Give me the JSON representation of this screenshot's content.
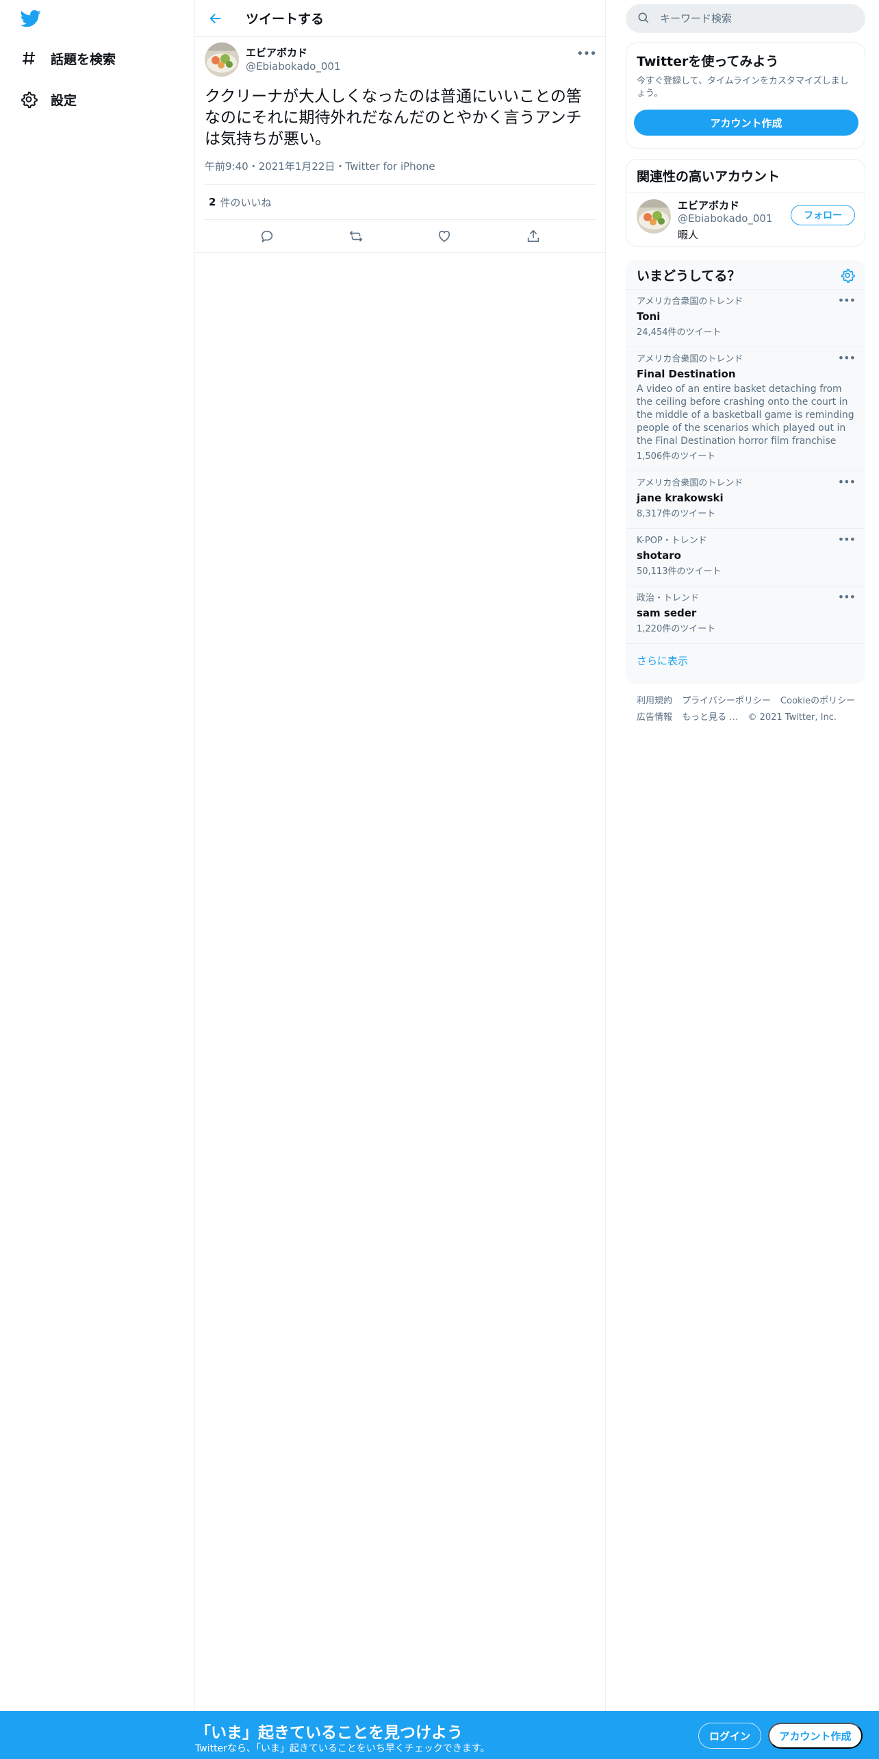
{
  "nav": {
    "explore_label": "話題を検索",
    "settings_label": "設定"
  },
  "header": {
    "title": "ツイートする"
  },
  "tweet": {
    "author_name": "エビアボカド",
    "author_handle": "@Ebiabokado_001",
    "text": "ククリーナが大人しくなったのは普通にいいことの筈なのにそれに期待外れだなんだのとやかく言うアンチは気持ちが悪い。",
    "time": "午前9:40",
    "sep1": "・",
    "date": "2021年1月22日",
    "sep2": "・",
    "source": "Twitter for iPhone",
    "like_count": "2",
    "like_label": "件のいいね"
  },
  "search": {
    "placeholder": "キーワード検索"
  },
  "signup_card": {
    "title": "Twitterを使ってみよう",
    "subtitle": "今すぐ登録して、タイムラインをカスタマイズしましょう。",
    "button": "アカウント作成"
  },
  "related": {
    "title": "関連性の高いアカウント",
    "name": "エビアボカド",
    "handle": "@Ebiabokado_001",
    "bio": "暇人",
    "follow": "フォロー"
  },
  "trends": {
    "title": "いまどうしてる？",
    "items": [
      {
        "context": "アメリカ合衆国のトレンド",
        "name": "Toni",
        "desc": "",
        "count": "24,454件のツイート"
      },
      {
        "context": "アメリカ合衆国のトレンド",
        "name": "Final Destination",
        "desc": "A video of an entire basket detaching from the ceiling before crashing onto the court in the middle of a basketball game is reminding people of the scenarios which played out in the Final Destination horror film franchise",
        "count": "1,506件のツイート"
      },
      {
        "context": "アメリカ合衆国のトレンド",
        "name": "jane krakowski",
        "desc": "",
        "count": "8,317件のツイート"
      },
      {
        "context": "K-POP・トレンド",
        "name": "shotaro",
        "desc": "",
        "count": "50,113件のツイート"
      },
      {
        "context": "政治・トレンド",
        "name": "sam seder",
        "desc": "",
        "count": "1,220件のツイート"
      }
    ],
    "show_more": "さらに表示"
  },
  "footer": {
    "terms": "利用規約",
    "privacy": "プライバシーポリシー",
    "cookie": "Cookieのポリシー",
    "ads": "広告情報",
    "more": "もっと見る …",
    "copyright": "© 2021 Twitter, Inc."
  },
  "bottom_bar": {
    "title": "「いま」起きていることを見つけよう",
    "subtitle": "Twitterなら、「いま」起きていることをいち早くチェックできます。",
    "login": "ログイン",
    "signup": "アカウント作成"
  },
  "colors": {
    "brand": "#1da1f2",
    "text": "#0f1419",
    "secondary": "#5b7083"
  }
}
